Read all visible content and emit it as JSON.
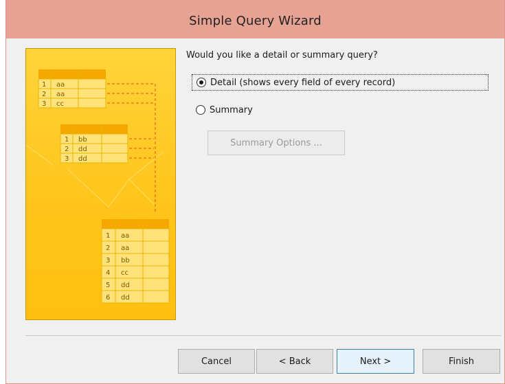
{
  "window": {
    "title": "Simple Query Wizard"
  },
  "question": "Would you like a detail or summary query?",
  "options": {
    "detail": {
      "label": "Detail (shows every field of every record)",
      "selected": true
    },
    "summary": {
      "label": "Summary",
      "selected": false
    }
  },
  "summary_options_button": {
    "label": "Summary Options ...",
    "enabled": false
  },
  "buttons": {
    "cancel": "Cancel",
    "back": "< Back",
    "next": "Next >",
    "finish": "Finish"
  },
  "illustration": {
    "table_a": [
      [
        "1",
        "aa"
      ],
      [
        "2",
        "aa"
      ],
      [
        "3",
        "cc"
      ]
    ],
    "table_b": [
      [
        "1",
        "bb"
      ],
      [
        "2",
        "dd"
      ],
      [
        "3",
        "dd"
      ]
    ],
    "table_c": [
      [
        "1",
        "aa"
      ],
      [
        "2",
        "aa"
      ],
      [
        "3",
        "bb"
      ],
      [
        "4",
        "cc"
      ],
      [
        "5",
        "dd"
      ],
      [
        "6",
        "dd"
      ]
    ],
    "colors": {
      "background": "#ffc51c",
      "cell": "#ffe27a",
      "header": "#f5a800",
      "text": "#7a5b00",
      "dash": "#e0531f"
    }
  },
  "colors": {
    "titlebar": "#e6a293",
    "window_bg": "#f0f0f0",
    "default_button_border": "#3c7fb1"
  }
}
